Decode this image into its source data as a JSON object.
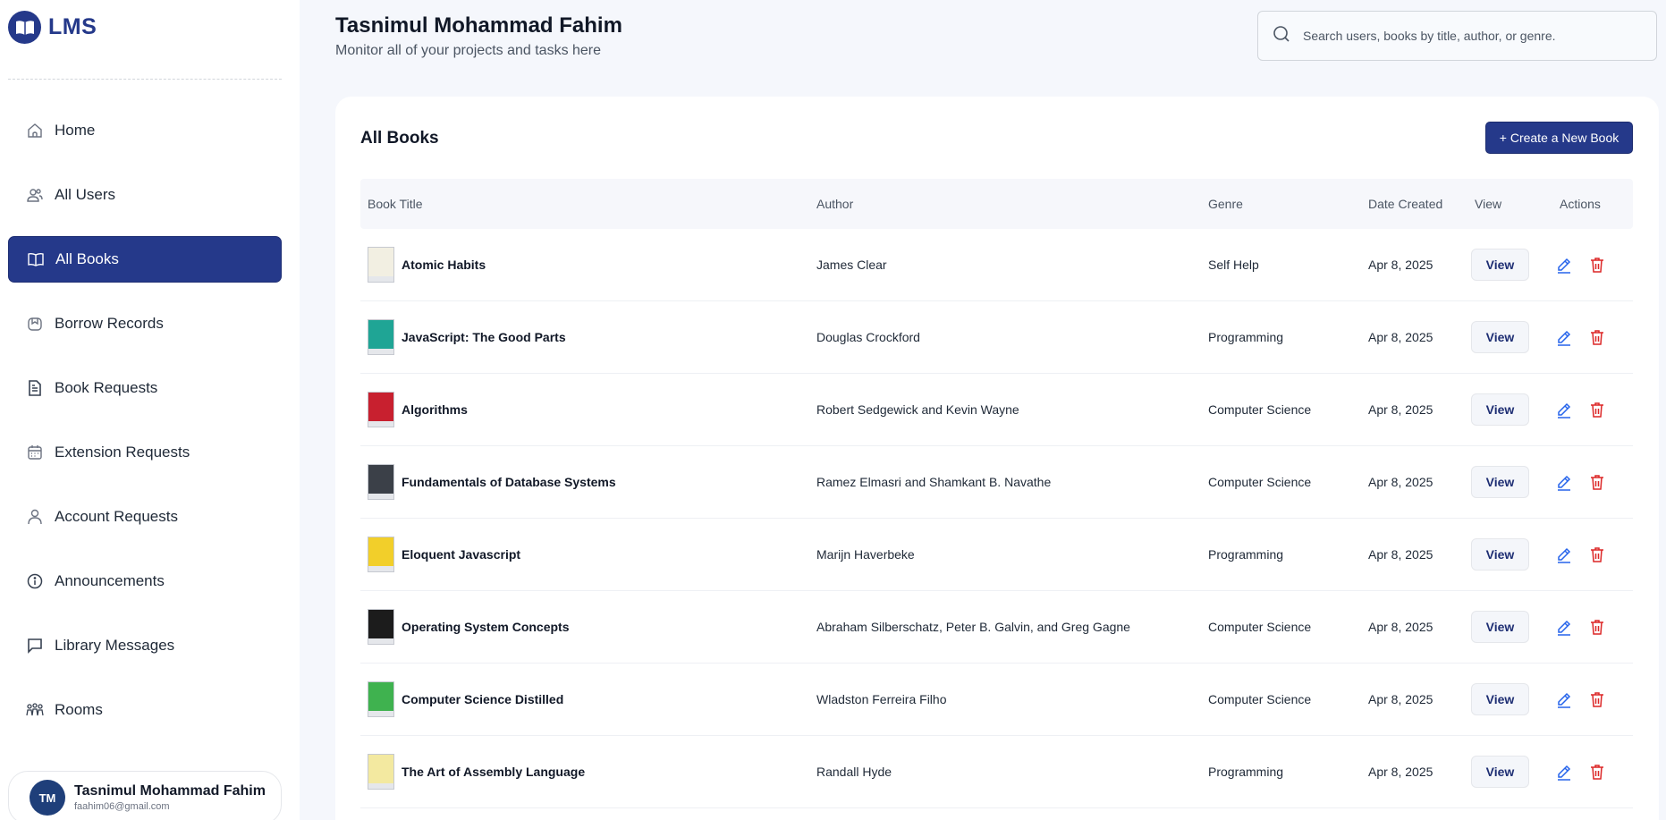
{
  "brand": {
    "name": "LMS"
  },
  "sidebar": {
    "items": [
      {
        "label": "Home",
        "icon": "home-icon",
        "active": false
      },
      {
        "label": "All Users",
        "icon": "users-icon",
        "active": false
      },
      {
        "label": "All Books",
        "icon": "book-open-icon",
        "active": true
      },
      {
        "label": "Borrow Records",
        "icon": "borrow-icon",
        "active": false
      },
      {
        "label": "Book Requests",
        "icon": "file-text-icon",
        "active": false
      },
      {
        "label": "Extension Requests",
        "icon": "calendar-icon",
        "active": false
      },
      {
        "label": "Account Requests",
        "icon": "user-icon",
        "active": false
      },
      {
        "label": "Announcements",
        "icon": "info-icon",
        "active": false
      },
      {
        "label": "Library Messages",
        "icon": "message-icon",
        "active": false
      },
      {
        "label": "Rooms",
        "icon": "group-icon",
        "active": false
      }
    ],
    "user": {
      "initials": "TM",
      "name": "Tasnimul Mohammad Fahim",
      "email": "faahim06@gmail.com"
    }
  },
  "header": {
    "title": "Tasnimul Mohammad Fahim",
    "subtitle": "Monitor all of your projects and tasks here",
    "search_placeholder": "Search users, books by title, author, or genre."
  },
  "main": {
    "title": "All Books",
    "create_label": "+ Create a New Book",
    "columns": [
      "Book Title",
      "Author",
      "Genre",
      "Date Created",
      "View",
      "Actions"
    ],
    "view_label": "View",
    "rows": [
      {
        "title": "Atomic Habits",
        "author": "James Clear",
        "genre": "Self Help",
        "date": "Apr 8, 2025",
        "cover": "#f2efe2"
      },
      {
        "title": "JavaScript: The Good Parts",
        "author": "Douglas Crockford",
        "genre": "Programming",
        "date": "Apr 8, 2025",
        "cover": "#1fa595"
      },
      {
        "title": "Algorithms",
        "author": "Robert Sedgewick and Kevin Wayne",
        "genre": "Computer Science",
        "date": "Apr 8, 2025",
        "cover": "#c8202f"
      },
      {
        "title": "Fundamentals of Database Systems",
        "author": "Ramez Elmasri and Shamkant B. Navathe",
        "genre": "Computer Science",
        "date": "Apr 8, 2025",
        "cover": "#3b4048"
      },
      {
        "title": "Eloquent Javascript",
        "author": "Marijn Haverbeke",
        "genre": "Programming",
        "date": "Apr 8, 2025",
        "cover": "#f2cf2a"
      },
      {
        "title": "Operating System Concepts",
        "author": "Abraham Silberschatz, Peter B. Galvin, and Greg Gagne",
        "genre": "Computer Science",
        "date": "Apr 8, 2025",
        "cover": "#1c1c1c"
      },
      {
        "title": "Computer Science Distilled",
        "author": "Wladston Ferreira Filho",
        "genre": "Computer Science",
        "date": "Apr 8, 2025",
        "cover": "#3fb24f"
      },
      {
        "title": "The Art of Assembly Language",
        "author": "Randall Hyde",
        "genre": "Programming",
        "date": "Apr 8, 2025",
        "cover": "#f3e9a0"
      }
    ]
  },
  "colors": {
    "primary": "#25398a",
    "edit": "#2563eb",
    "delete": "#dc2626",
    "background": "#f5f7fc"
  }
}
